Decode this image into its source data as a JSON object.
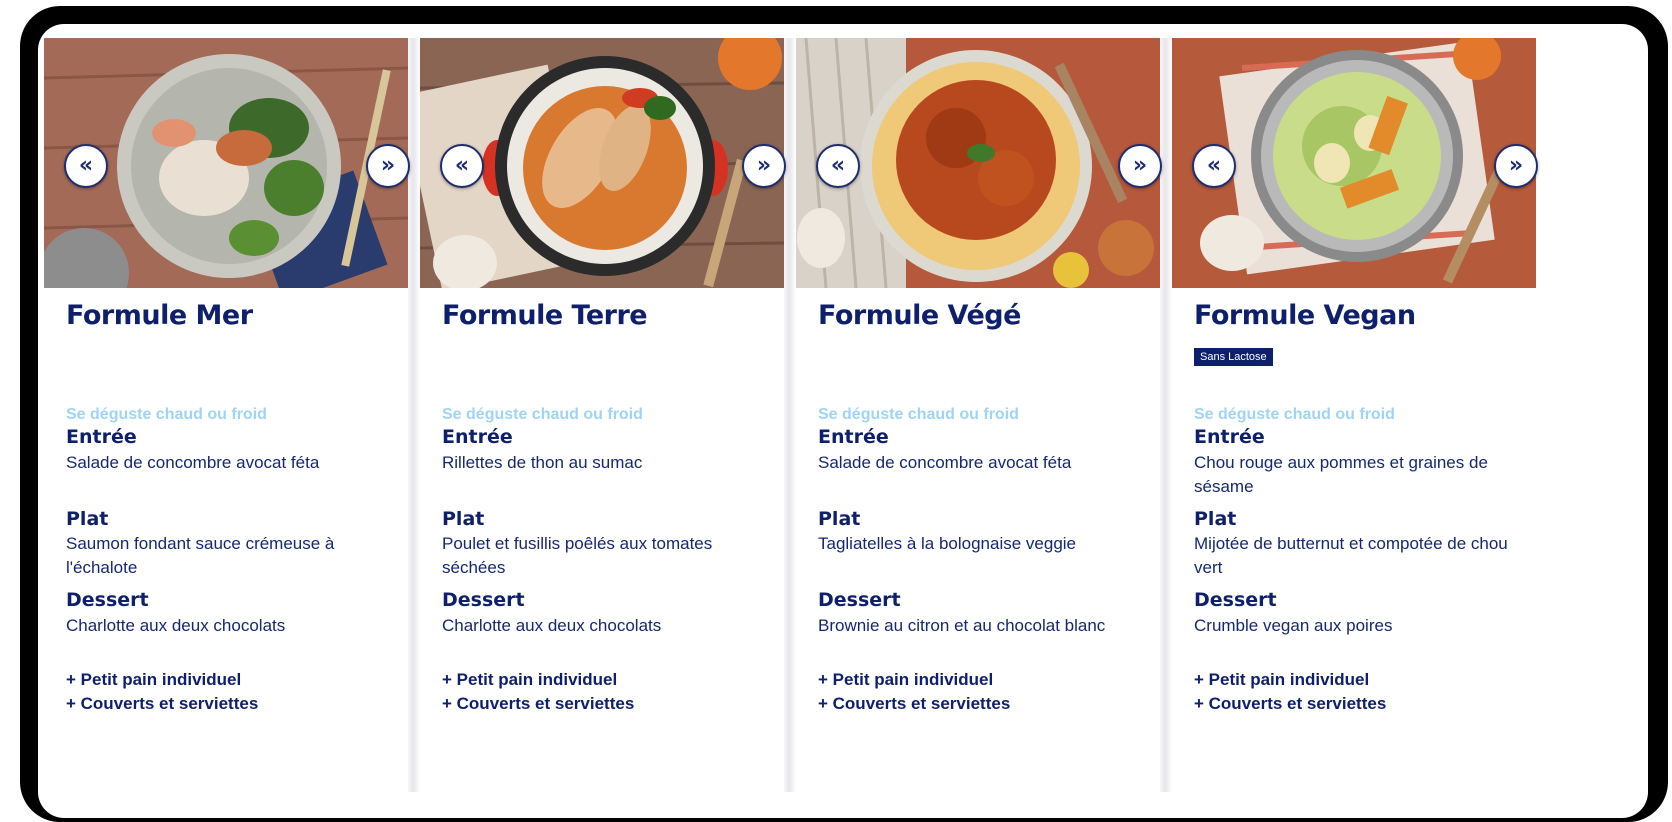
{
  "arrows": {
    "prev": "«",
    "next": "»"
  },
  "cards": [
    {
      "title": "Formule Mer",
      "badge": "",
      "hint": "Se déguste chaud ou froid",
      "starter_label": "Entrée",
      "starter": "Salade de concombre avocat féta",
      "main_label": "Plat",
      "main": "Saumon fondant sauce crémeuse à l'échalote",
      "dessert_label": "Dessert",
      "dessert": "Charlotte aux deux chocolats",
      "extra1": "+ Petit pain individuel",
      "extra2": "+ Couverts et serviettes",
      "photo": {
        "table": "#a46a58",
        "plate": "#c9c9c2",
        "food1": "#e9e0d3",
        "food2": "#3d6a2a",
        "food3": "#c76a3c",
        "cloth": "#2a3b6e"
      }
    },
    {
      "title": "Formule Terre",
      "badge": "",
      "hint": "Se déguste chaud ou froid",
      "starter_label": "Entrée",
      "starter": "Rillettes de thon au sumac",
      "main_label": "Plat",
      "main": "Poulet et fusillis poêlés aux tomates séchées",
      "dessert_label": "Dessert",
      "dessert": "Charlotte aux deux chocolats",
      "extra1": "+ Petit pain individuel",
      "extra2": "+ Couverts et serviettes",
      "photo": {
        "table": "#8b6553",
        "plate": "#2b2b2b",
        "food1": "#e7b98a",
        "food2": "#d9782f",
        "food3": "#cf3c22",
        "cloth": "#e4d6c7"
      }
    },
    {
      "title": "Formule Végé",
      "badge": "",
      "hint": "Se déguste chaud ou froid",
      "starter_label": "Entrée",
      "starter": "Salade de concombre avocat féta",
      "main_label": "Plat",
      "main": "Tagliatelles à la bolognaise veggie",
      "dessert_label": "Dessert",
      "dessert": "Brownie au citron et au chocolat blanc",
      "extra1": "+ Petit pain individuel",
      "extra2": "+ Couverts et serviettes",
      "photo": {
        "table": "#b5583c",
        "plate": "#dcd9d0",
        "food1": "#efc878",
        "food2": "#b8481e",
        "food3": "#7a2f18",
        "cloth": "#d9d2c8"
      }
    },
    {
      "title": "Formule Vegan",
      "badge": "Sans Lactose",
      "hint": "Se déguste chaud ou froid",
      "starter_label": "Entrée",
      "starter": "Chou rouge aux pommes et graines de sésame",
      "main_label": "Plat",
      "main": "Mijotée de butternut et compotée de chou vert",
      "dessert_label": "Dessert",
      "dessert": "Crumble vegan aux poires",
      "extra1": "+ Petit pain individuel",
      "extra2": "+ Couverts et serviettes",
      "photo": {
        "table": "#b65a3c",
        "plate": "#b9b9b9",
        "food1": "#c9dc8a",
        "food2": "#e38a2a",
        "food3": "#f0e6b5",
        "cloth": "#eae0d7"
      }
    }
  ]
}
